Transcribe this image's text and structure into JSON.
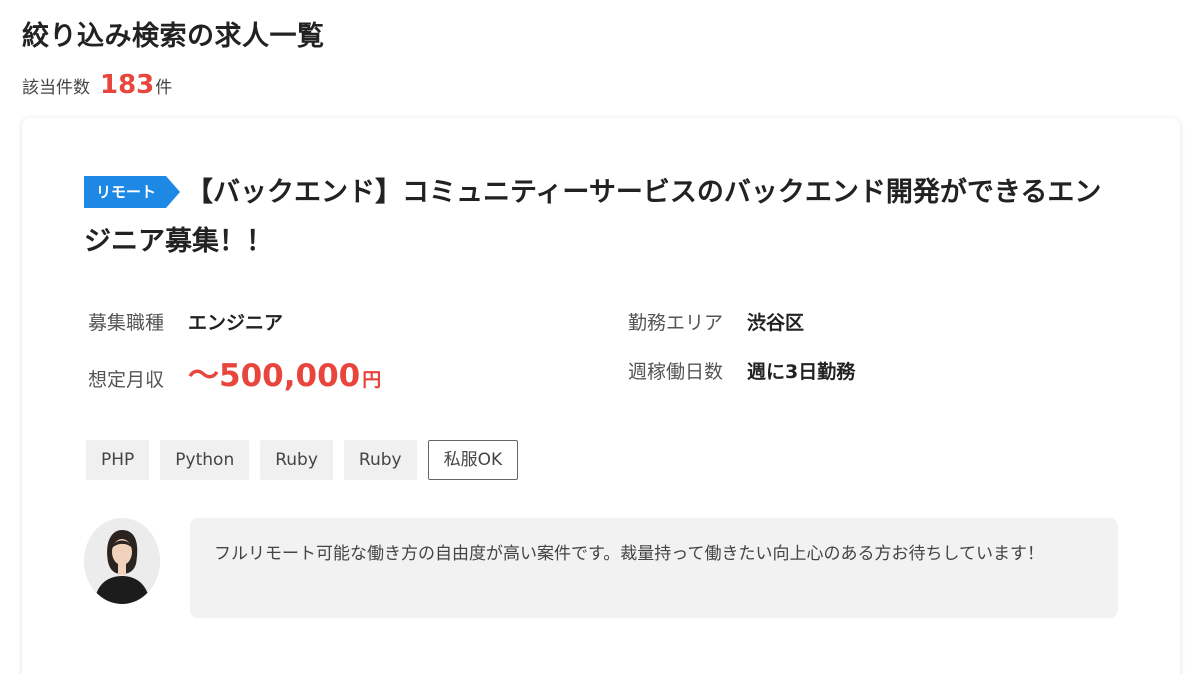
{
  "page": {
    "title": "絞り込み検索の求人一覧",
    "count_label": "該当件数",
    "count_value": "183",
    "count_unit": "件"
  },
  "job": {
    "remote_tag": "リモート",
    "title": "【バックエンド】コミュニティーサービスのバックエンド開発ができるエンジニア募集！！",
    "info": {
      "category_label": "募集職種",
      "category_value": "エンジニア",
      "area_label": "勤務エリア",
      "area_value": "渋谷区",
      "salary_label": "想定月収",
      "salary_value": "〜500,000",
      "salary_unit": "円",
      "days_label": "週稼働日数",
      "days_value": "週に3日勤務"
    },
    "tags": [
      "PHP",
      "Python",
      "Ruby",
      "Ruby"
    ],
    "outline_tag": "私服OK",
    "comment": "フルリモート可能な働き方の自由度が高い案件です。裁量持って働きたい向上心のある方お待ちしています！"
  },
  "colors": {
    "accent_red": "#e8453c",
    "remote_blue": "#1e88e5"
  },
  "icons": {
    "avatar": "recruiter-avatar"
  }
}
